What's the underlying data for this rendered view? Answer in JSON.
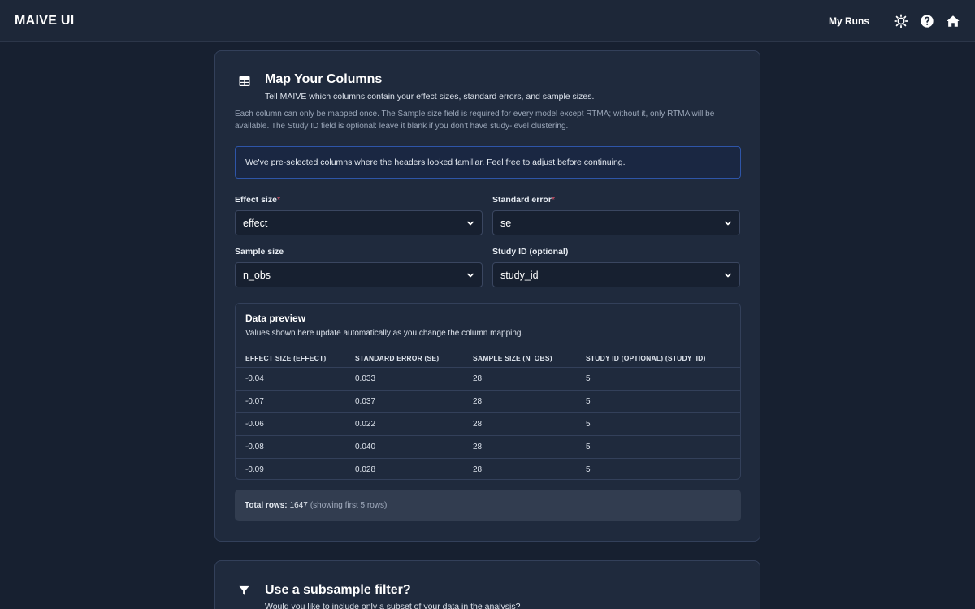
{
  "app": {
    "title": "MAIVE UI"
  },
  "nav": {
    "my_runs": "My Runs",
    "icons": [
      "sun-icon",
      "help-icon",
      "home-icon"
    ]
  },
  "map_columns": {
    "title": "Map Your Columns",
    "icon": "table-icon",
    "subtitle": "Tell MAIVE which columns contain your effect sizes, standard errors, and sample sizes.",
    "description": "Each column can only be mapped once. The Sample size field is required for every model except RTMA; without it, only RTMA will be available. The Study ID field is optional: leave it blank if you don't have study-level clustering.",
    "info": "We've pre-selected columns where the headers looked familiar. Feel free to adjust before continuing.",
    "fields": {
      "effect_size": {
        "label": "Effect size",
        "required_mark": "*",
        "value": "effect"
      },
      "standard_error": {
        "label": "Standard error",
        "required_mark": "*",
        "value": "se"
      },
      "sample_size": {
        "label": "Sample size",
        "value": "n_obs"
      },
      "study_id": {
        "label": "Study ID (optional)",
        "value": "study_id"
      }
    }
  },
  "preview": {
    "title": "Data preview",
    "subtitle": "Values shown here update automatically as you change the column mapping.",
    "columns": [
      "EFFECT SIZE (EFFECT)",
      "STANDARD ERROR (SE)",
      "SAMPLE SIZE (N_OBS)",
      "STUDY ID (OPTIONAL) (STUDY_ID)"
    ],
    "rows": [
      [
        "-0.04",
        "0.033",
        "28",
        "5"
      ],
      [
        "-0.07",
        "0.037",
        "28",
        "5"
      ],
      [
        "-0.06",
        "0.022",
        "28",
        "5"
      ],
      [
        "-0.08",
        "0.040",
        "28",
        "5"
      ],
      [
        "-0.09",
        "0.028",
        "28",
        "5"
      ]
    ],
    "total_label": "Total rows:",
    "total_value": "1647",
    "total_note": "(showing first 5 rows)"
  },
  "subsample": {
    "title": "Use a subsample filter?",
    "icon": "filter-icon",
    "subtitle": "Would you like to include only a subset of your data in the analysis?"
  },
  "colors": {
    "background": "#172030",
    "card": "#1f2a3d",
    "info_border": "#2e55a8",
    "required": "#e0566b"
  }
}
